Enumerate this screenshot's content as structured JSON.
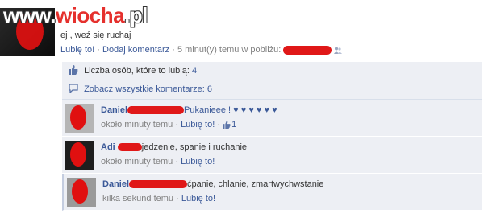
{
  "watermark": {
    "part1": "www.",
    "part2": "wiocha",
    "part3": ".pl"
  },
  "post": {
    "text": "ej , weź się ruchaj",
    "like_label": "Lubię to!",
    "comment_label": "Dodaj komentarz",
    "timestamp": "5 minut(y) temu w pobliżu:"
  },
  "ufi": {
    "likes_label": "Liczba osób, które to lubią:",
    "likes_count": "4",
    "view_all_label": "Zobacz wszystkie komentarze: 6"
  },
  "comments": [
    {
      "author": "Daniel",
      "text": "Pukanieee ! ♥ ♥ ♥ ♥ ♥ ♥",
      "time": "około minuty temu",
      "like_label": "Lubię to!",
      "like_count": "1"
    },
    {
      "author": "Adi",
      "text": "jedzenie, spanie i ruchanie",
      "time": "około minuty temu",
      "like_label": "Lubię to!"
    },
    {
      "author": "Daniel",
      "text": "ćpanie, chlanie, zmartwychwstanie",
      "time": "kilka sekund temu",
      "like_label": "Lubię to!"
    }
  ],
  "colors": {
    "link": "#3b5998",
    "panel": "#edeff4",
    "redaction": "#e01818"
  },
  "icons": [
    "thumbs-up-icon",
    "comment-bubble-icon",
    "people-icon"
  ]
}
